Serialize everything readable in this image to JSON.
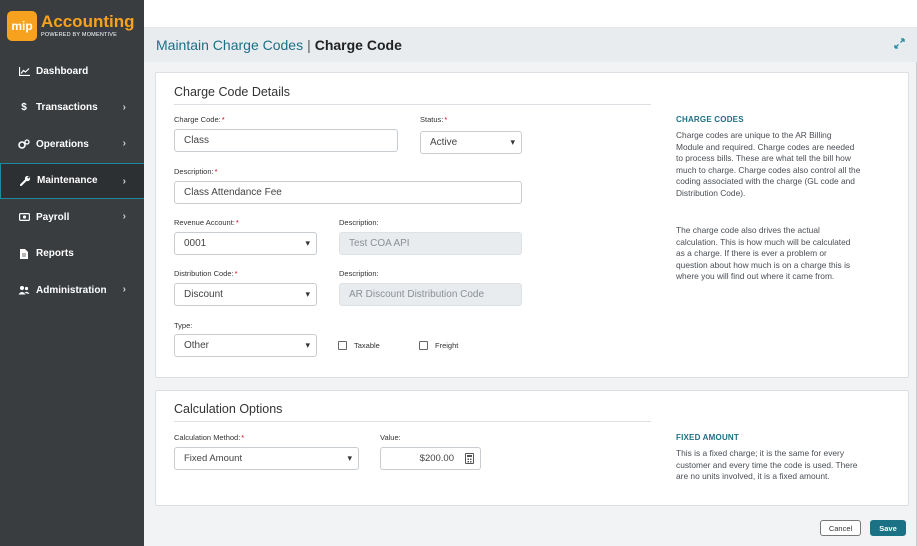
{
  "brand": {
    "logo_mark": "mip",
    "name": "Accounting",
    "powered_by": "POWERED BY MOMENTIVE"
  },
  "sidebar": {
    "items": [
      {
        "label": "Dashboard",
        "icon": "chart-line-icon",
        "has_children": false
      },
      {
        "label": "Transactions",
        "icon": "dollar-icon",
        "has_children": true
      },
      {
        "label": "Operations",
        "icon": "gears-icon",
        "has_children": true
      },
      {
        "label": "Maintenance",
        "icon": "wrench-icon",
        "has_children": true,
        "active": true
      },
      {
        "label": "Payroll",
        "icon": "money-icon",
        "has_children": true
      },
      {
        "label": "Reports",
        "icon": "file-icon",
        "has_children": false
      },
      {
        "label": "Administration",
        "icon": "users-icon",
        "has_children": true
      }
    ]
  },
  "header": {
    "breadcrumb": "Maintain Charge Codes",
    "separator": "|",
    "title": "Charge Code"
  },
  "details": {
    "section_title": "Charge Code Details",
    "charge_code": {
      "label": "Charge Code:",
      "value": "Class"
    },
    "status": {
      "label": "Status:",
      "value": "Active"
    },
    "description": {
      "label": "Description:",
      "value": "Class Attendance Fee"
    },
    "revenue_account": {
      "label": "Revenue Account:",
      "value": "0001"
    },
    "revenue_description": {
      "label": "Description:",
      "value": "Test COA API"
    },
    "distribution_code": {
      "label": "Distribution Code:",
      "value": "Discount"
    },
    "distribution_description": {
      "label": "Description:",
      "value": "AR Discount Distribution Code"
    },
    "type": {
      "label": "Type:",
      "value": "Other"
    },
    "taxable_label": "Taxable",
    "freight_label": "Freight",
    "help_title": "CHARGE CODES",
    "help_p1_lines": [
      "Charge codes are unique to the AR Billing",
      "Module and required. Charge codes are needed",
      "to process bills. These are what tell the bill how",
      "much to charge. Charge codes also control all the",
      "coding associated with the charge (GL code and",
      "Distribution Code)."
    ],
    "help_p2_lines": [
      "The charge code also drives the actual",
      "calculation. This is how much will be calculated",
      "as a charge. If there is ever a problem or",
      "question about how much is on a charge this is",
      "where you will find out where it came from."
    ]
  },
  "calc": {
    "section_title": "Calculation Options",
    "method": {
      "label": "Calculation Method:",
      "value": "Fixed Amount"
    },
    "value": {
      "label": "Value:",
      "value": "$200.00"
    },
    "help_title": "FIXED AMOUNT",
    "help_lines": [
      "This is a fixed charge; it is the same for every",
      "customer and every time the code is used. There",
      "are no units involved, it is a fixed amount."
    ]
  },
  "footer": {
    "cancel_label": "Cancel",
    "save_label": "Save"
  },
  "colors": {
    "sidebar_bg": "#3a3d40",
    "brand_orange": "#f6a21e",
    "accent_teal": "#1b7284",
    "required_red": "#d0021b"
  }
}
